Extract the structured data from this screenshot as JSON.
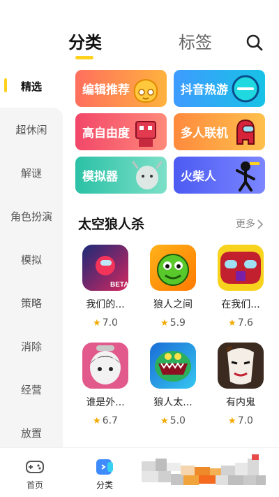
{
  "header": {
    "tabs": [
      {
        "label": "分类",
        "active": true
      },
      {
        "label": "标签",
        "active": false
      }
    ],
    "search_icon": "search-icon"
  },
  "sidebar": {
    "items": [
      {
        "label": "精选",
        "active": true
      },
      {
        "label": "超休闲"
      },
      {
        "label": "解谜"
      },
      {
        "label": "角色扮演"
      },
      {
        "label": "模拟"
      },
      {
        "label": "策略"
      },
      {
        "label": "消除"
      },
      {
        "label": "经营"
      },
      {
        "label": "放置"
      }
    ]
  },
  "categories": [
    {
      "label": "编辑推荐",
      "color_from": "#FF6F5E",
      "color_to": "#FFB23E"
    },
    {
      "label": "抖音热游",
      "color_from": "#3E9BFF",
      "color_to": "#17C2E6"
    },
    {
      "label": "高自由度",
      "color_from": "#F24769",
      "color_to": "#FF8A7A"
    },
    {
      "label": "多人联机",
      "color_from": "#FF8A3D",
      "color_to": "#FFC04D"
    },
    {
      "label": "模拟器",
      "color_from": "#2BC1A6",
      "color_to": "#7DE0C8"
    },
    {
      "label": "火柴人",
      "color_from": "#4C5BF2",
      "color_to": "#7B86FF"
    }
  ],
  "section": {
    "title": "太空狼人杀",
    "more_label": "更多"
  },
  "games": [
    {
      "name": "我们的...",
      "rating": "7.0"
    },
    {
      "name": "狼人之间",
      "rating": "5.9"
    },
    {
      "name": "在我们...",
      "rating": "7.6"
    },
    {
      "name": "谁是外...",
      "rating": "6.7"
    },
    {
      "name": "狼人太...",
      "rating": "5.0"
    },
    {
      "name": "有内鬼",
      "rating": "7.0"
    }
  ],
  "bottom_nav": {
    "items": [
      {
        "label": "首页",
        "icon": "gamepad-icon"
      },
      {
        "label": "分类",
        "icon": "category-icon",
        "active": true
      }
    ]
  },
  "colors": {
    "accent": "#FFD21F",
    "star": "#F2A900"
  }
}
